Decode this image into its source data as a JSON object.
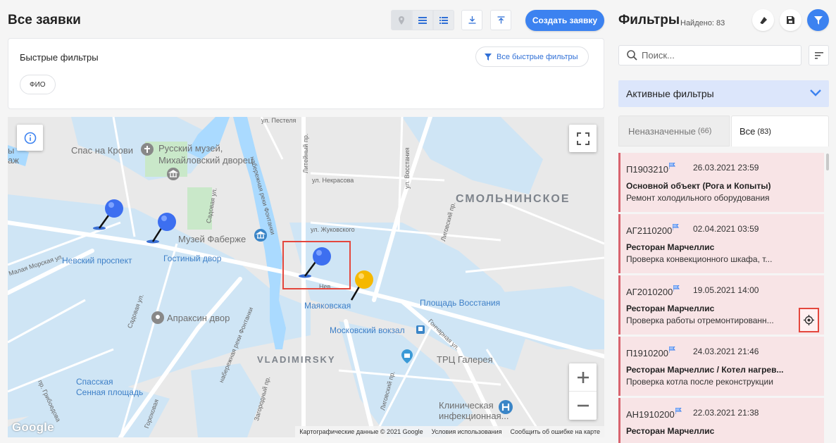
{
  "header": {
    "title": "Все заявки",
    "create_label": "Создать заявку"
  },
  "quick_filters": {
    "title": "Быстрые фильтры",
    "all_label": "Все быстрые фильтры",
    "chips": [
      "ФИО"
    ]
  },
  "map": {
    "labels": {
      "spas": "Спас на Крови",
      "russian_museum": "Русский музей,",
      "mikhailovsky": "Михайловский дворец",
      "faberge": "Музей Фаберже",
      "nevsky_prospekt": "Невский проспект",
      "gostiny_dvor": "Гостиный двор",
      "apraksin": "Апраксин двор",
      "mayakovskaya": "Маяковская",
      "ploshchad_vosstaniya": "Площадь Восстания",
      "moskovsky_vokzal": "Московский вокзал",
      "trc_galereya": "ТРЦ Галерея",
      "spasskaya": "Спасская",
      "sennaya": "Сенная площадь",
      "clinic_1": "Клиническая",
      "clinic_2": "инфекционная...",
      "smolninskoe": "СМОЛЬНИНСКОЕ",
      "vladimirsky": "VLADIMIRSKY",
      "pestelya": "ул. Пестеля",
      "nekrasova": "ул. Некрасова",
      "zhukovskogo": "ул. Жуковского",
      "liteyny": "Литейный пр.",
      "vosstaniya": "ул. Восстания",
      "ligovsky": "Лиговский пр.",
      "ligovsky2": "Лиговский пр.",
      "sadovaya": "Садовая ул.",
      "sadovaya2": "Садовая ул.",
      "fontanka": "набережная реки Фонтанки",
      "fontanka2": "набережная реки Фонтанки",
      "goncharnaya": "Гончарная ул.",
      "zagorodny": "Загородный пр.",
      "griboyedova": "пр. Грибоедова",
      "morskaya": "Малая Морская ул.",
      "nevsky_short": "Нев",
      "gorokhovaya": "Гороховая",
      "left_edge_1": "ы",
      "left_edge_2": "аж"
    },
    "attribution": [
      "Картографические данные © 2021 Google",
      "Условия использования",
      "Сообщить об ошибке на карте"
    ],
    "google": "Google"
  },
  "filters_panel": {
    "title": "Фильтры",
    "found": "Найдено: 83",
    "search_placeholder": "Поиск...",
    "active_filters_label": "Активные фильтры",
    "tabs": [
      {
        "label": "Неназначенные",
        "count": "(66)"
      },
      {
        "label": "Все",
        "count": "(83)"
      }
    ]
  },
  "requests": [
    {
      "number": "П1903210",
      "date": "26.03.2021 23:59",
      "object": "Основной объект (Рога и Копыты)",
      "description": "Ремонт холодильного оборудования"
    },
    {
      "number": "АГ2110200",
      "date": "02.04.2021 03:59",
      "object": "Ресторан Марчеллис",
      "description": "Проверка конвекционного шкафа, т..."
    },
    {
      "number": "АГ2010200",
      "date": "19.05.2021 14:00",
      "object": "Ресторан Марчеллис",
      "description": "Проверка работы отремонтированн..."
    },
    {
      "number": "П1910200",
      "date": "24.03.2021 21:46",
      "object": "Ресторан Марчеллис / Котел нагрев...",
      "description": "Проверка котла после реконструкции"
    },
    {
      "number": "АН1910200",
      "date": "22.03.2021 21:38",
      "object": "Ресторан Марчеллис",
      "description": ""
    }
  ],
  "colors": {
    "accent": "#3c82f0",
    "card_bg": "#f8e4e6",
    "card_border": "#d8646f",
    "highlight": "#e4473d",
    "pin_blue": "#3d6ff0",
    "pin_yellow": "#f5b800"
  }
}
